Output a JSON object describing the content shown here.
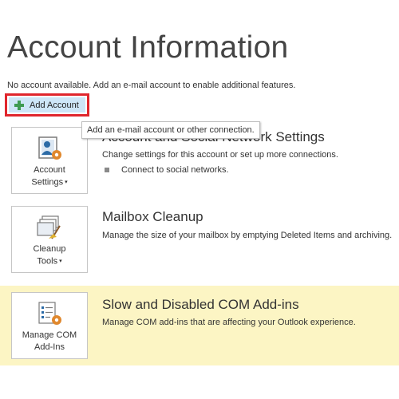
{
  "page": {
    "title": "Account Information",
    "info_text": "No account available. Add an e-mail account to enable additional features."
  },
  "add_account": {
    "label": "Add Account",
    "icon": "plus-icon",
    "tooltip": "Add an e-mail account or other connection.",
    "border_color": "#e0262d",
    "fill_color": "#cde6f7"
  },
  "sections": [
    {
      "button_line1": "Account",
      "button_line2": "Settings",
      "has_dropdown": true,
      "icon": "account-settings-icon",
      "title": "Account and Social Network Settings",
      "description": "Change settings for this account or set up more connections.",
      "bullets": [
        "Connect to social networks."
      ]
    },
    {
      "button_line1": "Cleanup",
      "button_line2": "Tools",
      "has_dropdown": true,
      "icon": "cleanup-tools-icon",
      "title": "Mailbox Cleanup",
      "description": "Manage the size of your mailbox by emptying Deleted Items and archiving."
    },
    {
      "button_line1": "Manage COM",
      "button_line2": "Add-Ins",
      "has_dropdown": false,
      "icon": "manage-com-addins-icon",
      "title": "Slow and Disabled COM Add-ins",
      "description": "Manage COM add-ins that are affecting your Outlook experience.",
      "highlight_color": "#fcf5c4"
    }
  ],
  "dropdown_glyph": "▾"
}
